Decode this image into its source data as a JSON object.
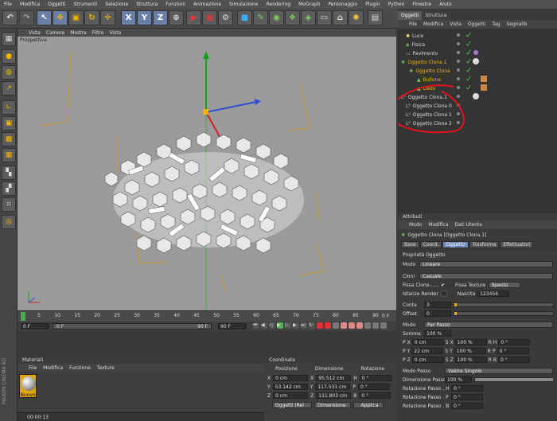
{
  "menubar": [
    "File",
    "Modifica",
    "Oggetti",
    "Strumenti",
    "Selezione",
    "Struttura",
    "Funzioni",
    "Animazione",
    "Simulazione",
    "Rendering",
    "MoGraph",
    "Personaggio",
    "Plugin",
    "Python",
    "Finestre",
    "Aiuto"
  ],
  "toolbar": {
    "x_label": "X",
    "y_label": "Y",
    "z_label": "Z"
  },
  "viewport": {
    "menu": [
      "Vista",
      "Camere",
      "Mostra",
      "Filtro",
      "Vista"
    ],
    "label": "Prospettiva"
  },
  "right_tabs": [
    "Oggetti",
    "Struttura"
  ],
  "obj_menu": [
    "File",
    "Modifica",
    "Vista",
    "Oggetti",
    "Tag",
    "Segnalib"
  ],
  "objects": [
    "Luce",
    "Fisica",
    "Pavimento",
    "Oggetto Clona.1",
    "Oggetto Clona",
    "Bullone",
    "Dado",
    "Oggetto Clona.1",
    "Oggetto Clona 0",
    "Oggetto Clona 1",
    "Oggetto Clona 2"
  ],
  "attributes": {
    "header": "Attributi",
    "menu": [
      "Modo",
      "Modifica",
      "Dati Utente"
    ],
    "title": "Oggetto Clona [Oggetto Clona.1]",
    "tabs": [
      "Base",
      "Coord.",
      "Oggetto",
      "Trasforma",
      "Effettuatori"
    ],
    "section": "Proprietà Oggetto",
    "modo_label": "Modo",
    "modo_value": "Lineare",
    "cloni_label": "Cloni",
    "cloni_value": "Casuale",
    "fissa_clone": "Fissa Clone......",
    "fissa_texture": "Fissa Texture",
    "fissa_texture_value": "Spento",
    "istanze": "Istanze Render",
    "nascita_label": "Nascita",
    "nascita_value": "123456",
    "conta_label": "Conta",
    "conta_value": "3",
    "offset_label": "Offset",
    "offset_value": "0",
    "modo2_label": "Modo",
    "modo2_value": "Per Passo",
    "somma_label": "Somma",
    "somma_value": "100 %",
    "p_label": "P",
    "s_label": "S",
    "r_label": "R",
    "px": "0 cm",
    "py": "22 cm",
    "pz": "0 cm",
    "sx": "100 %",
    "sy": "100 %",
    "sz": "100 %",
    "rh": "0 °",
    "rp": "0 °",
    "rb": "0 °",
    "modo_passo_label": "Modo Passo",
    "modo_passo_value": "Valore Singolo",
    "dim_passo_label": "Dimensione Passo",
    "dim_passo_value": "100 %",
    "rot_h_label": "Rotazione Passo . H",
    "rot_h": "0 °",
    "rot_p_label": "Rotazione Passo . P",
    "rot_p": "0 °",
    "rot_b_label": "Rotazione Passo . B",
    "rot_b": "0 °"
  },
  "timeline": {
    "ticks": [
      "0",
      "5",
      "10",
      "15",
      "20",
      "25",
      "30",
      "35",
      "40",
      "45",
      "50",
      "55",
      "60",
      "65",
      "70",
      "75",
      "80",
      "85",
      "90"
    ],
    "end": "0 F"
  },
  "playbar": {
    "start": "0 F",
    "current": "0 F",
    "end_a": "90 F",
    "end_b": "90 F"
  },
  "materials": {
    "header": "Materiali",
    "menu": [
      "File",
      "Modifica",
      "Funzione",
      "Texture"
    ],
    "item": "Nuovo"
  },
  "coords": {
    "header": "Coordinate",
    "cols": [
      "Posizione",
      "Dimensione",
      "Rotazione"
    ],
    "rows": [
      {
        "a": "X",
        "pos": "0 cm",
        "b": "X",
        "dim": "95.512 cm",
        "c": "H",
        "rot": "0 °"
      },
      {
        "a": "Y",
        "pos": "53.142 cm",
        "b": "Y",
        "dim": "117.531 cm",
        "c": "P",
        "rot": "0 °"
      },
      {
        "a": "Z",
        "pos": "0 cm",
        "b": "Z",
        "dim": "111.803 cm",
        "c": "B",
        "rot": "0 °"
      }
    ],
    "mode": "Oggetti (Rel",
    "mode2": "Dimensione",
    "apply": "Applica"
  },
  "status": {
    "time": "00:00:13",
    "brand": "MAXON CINEMA 4D"
  }
}
